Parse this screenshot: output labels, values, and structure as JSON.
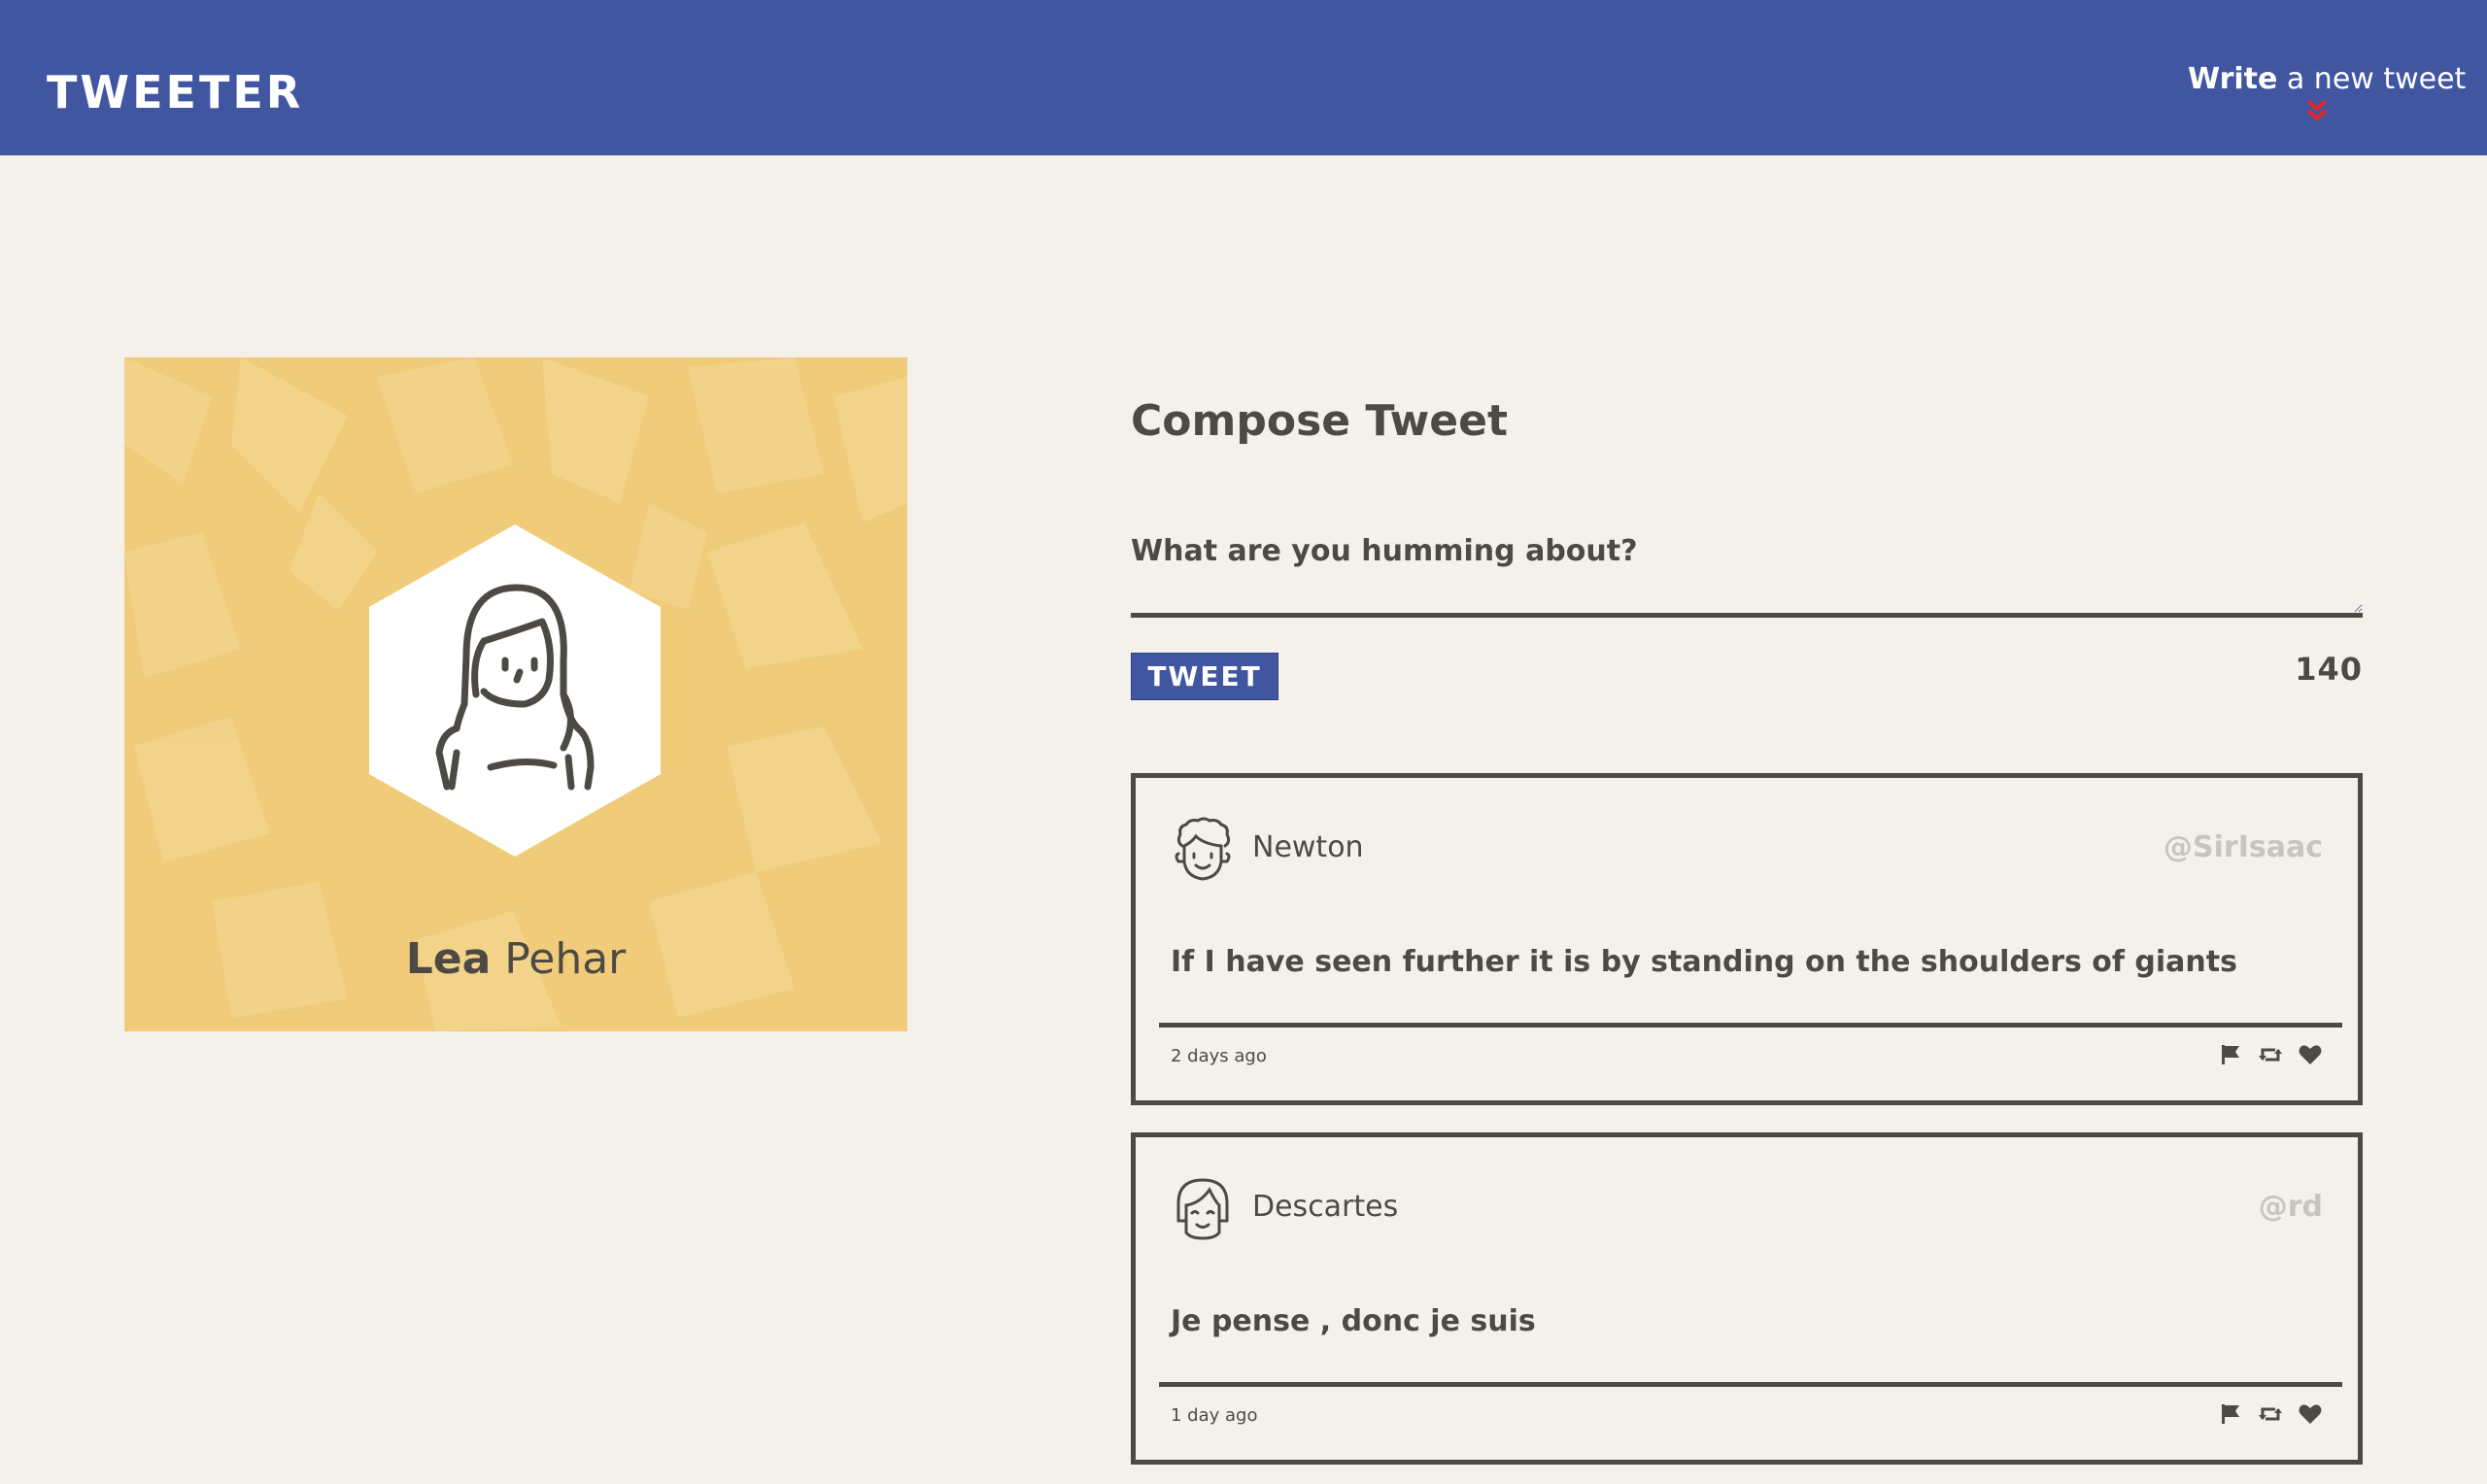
{
  "nav": {
    "brand": "TWEETER",
    "compose_bold": "Write",
    "compose_rest": " a new tweet",
    "compose_icon": "chevron-double-down-icon",
    "compose_icon_color": "#e0262b"
  },
  "colors": {
    "nav_bg": "#4056a1",
    "page_bg": "#f4f1ec",
    "text": "#4d4a45",
    "profile_bg": "#f0cc7a",
    "handle": "#c8c5c0"
  },
  "profile": {
    "first_name": "Lea",
    "last_name": " Pehar",
    "avatar_icon": "woman-avatar-icon"
  },
  "compose": {
    "title": "Compose Tweet",
    "placeholder": "What are you humming about?",
    "button_label": "TWEET",
    "counter": "140"
  },
  "tweets": [
    {
      "name": "Newton",
      "handle": "@SirIsaac",
      "content": "If I have seen further it is by standing on the shoulders of giants",
      "time": "2 days ago",
      "avatar_icon": "curly-hair-avatar-icon"
    },
    {
      "name": "Descartes",
      "handle": "@rd",
      "content": "Je pense , donc je suis",
      "time": "1 day ago",
      "avatar_icon": "bob-hair-avatar-icon"
    }
  ],
  "tweet_actions": [
    "flag-icon",
    "retweet-icon",
    "heart-icon"
  ]
}
